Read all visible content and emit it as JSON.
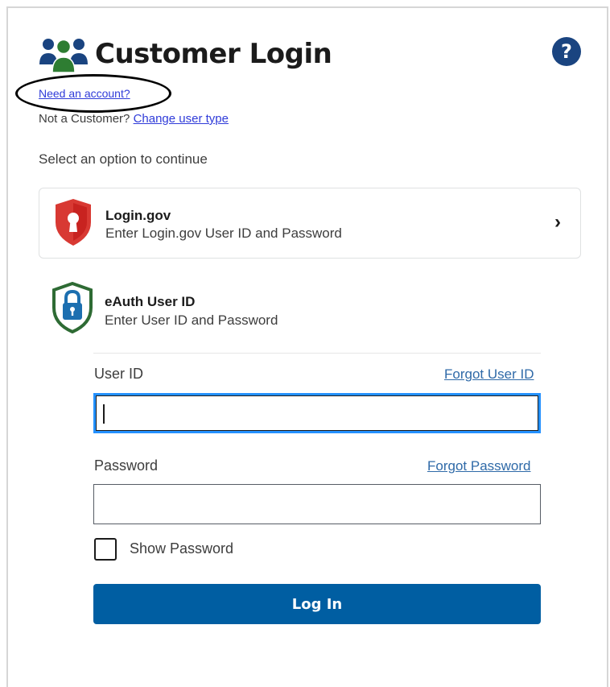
{
  "header": {
    "title": "Customer Login",
    "title_icon": "users-group-icon",
    "help_icon": "question-circle-icon",
    "help_label": "?"
  },
  "links": {
    "need_account": "Need an account?",
    "not_customer_prefix": "Not a Customer?",
    "change_user_type": "Change user type"
  },
  "prompt": "Select an option to continue",
  "logingov": {
    "title": "Login.gov",
    "subtitle": "Enter Login.gov User ID and Password",
    "icon": "keyhole-shield-icon",
    "chevron": "›"
  },
  "eauth": {
    "title": "eAuth User ID",
    "subtitle": "Enter User ID and Password",
    "icon": "padlock-shield-icon"
  },
  "form": {
    "user_id_label": "User ID",
    "forgot_user_id": "Forgot User ID",
    "user_id_value": "",
    "password_label": "Password",
    "forgot_password": "Forgot Password",
    "password_value": "",
    "show_password_label": "Show Password",
    "show_password_checked": false,
    "login_button": "Log In"
  },
  "colors": {
    "primary": "#005ea2",
    "help_icon": "#1a4480",
    "link": "#2f3bd9",
    "focus": "#2491ff",
    "logingov_red": "#d83933",
    "eauth_green": "#2e6b34",
    "eauth_blue": "#1c6fb0",
    "users_icon_blue": "#1a4480",
    "users_icon_green": "#2e7d32"
  }
}
